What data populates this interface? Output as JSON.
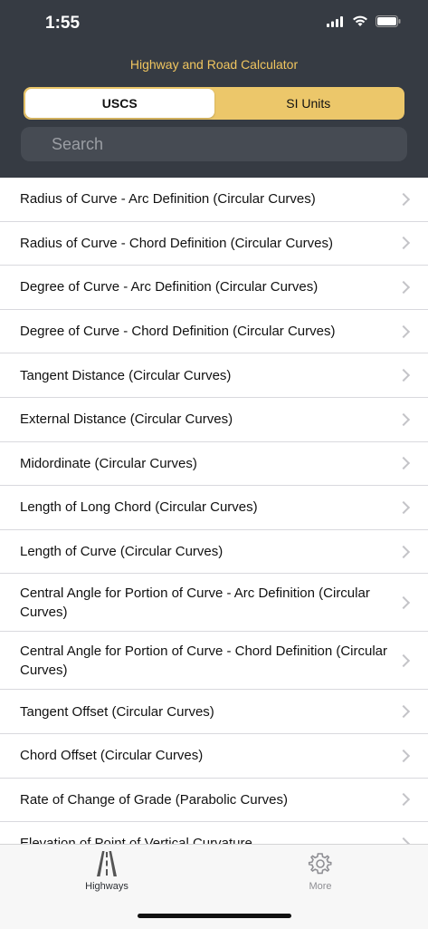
{
  "status": {
    "time": "1:55"
  },
  "header": {
    "title": "Highway and Road Calculator"
  },
  "units": {
    "options": [
      "USCS",
      "SI Units"
    ],
    "selected": "USCS"
  },
  "search": {
    "placeholder": "Search"
  },
  "list": {
    "items": [
      "Radius of Curve - Arc Definition (Circular Curves)",
      "Radius of Curve - Chord Definition (Circular Curves)",
      "Degree of Curve - Arc Definition (Circular Curves)",
      "Degree of Curve - Chord Definition (Circular Curves)",
      "Tangent Distance (Circular Curves)",
      "External Distance (Circular Curves)",
      "Midordinate (Circular Curves)",
      "Length of Long Chord (Circular Curves)",
      "Length of Curve (Circular Curves)",
      "Central Angle for Portion of Curve - Arc Definition (Circular Curves)",
      "Central Angle for Portion of Curve - Chord Definition (Circular Curves)",
      "Tangent Offset (Circular Curves)",
      "Chord Offset (Circular Curves)",
      "Rate of Change of Grade (Parabolic Curves)",
      "Elevation of Point of Vertical Curvature"
    ]
  },
  "tabs": [
    {
      "label": "Highways",
      "icon": "road-icon",
      "active": true
    },
    {
      "label": "More",
      "icon": "gear-icon",
      "active": false
    }
  ],
  "colors": {
    "header_bg": "#363b43",
    "accent": "#ecc76a",
    "title": "#f0c55f"
  }
}
